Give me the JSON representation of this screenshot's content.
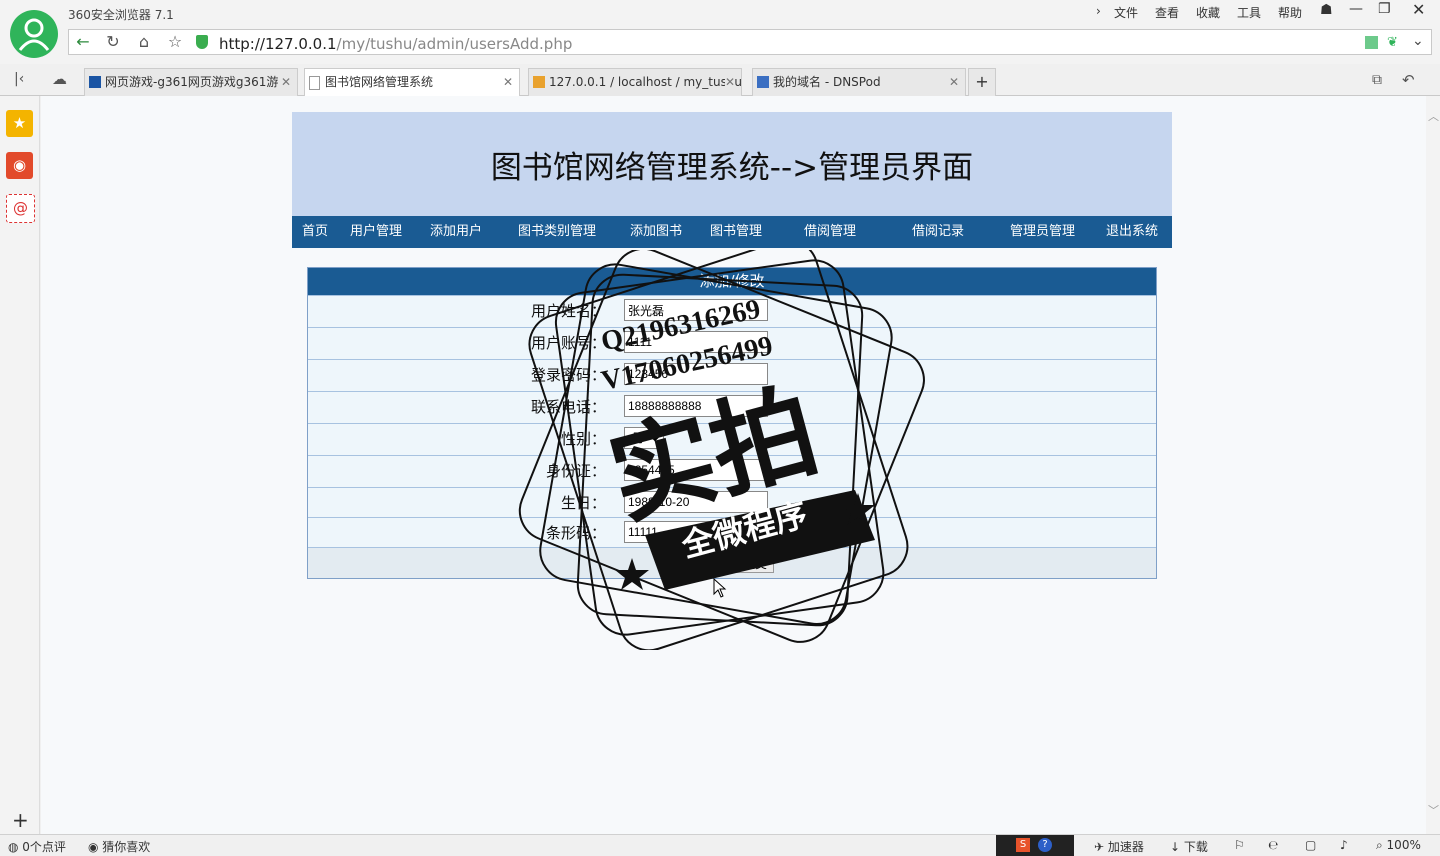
{
  "browser": {
    "title": "360安全浏览器 7.1",
    "menu": [
      "文件",
      "查看",
      "收藏",
      "工具",
      "帮助"
    ],
    "url_host": "http://127.0.0.1",
    "url_path": "/my/tushu/admin/usersAdd.php"
  },
  "tabs": [
    {
      "label": "网页游戏-g361网页游戏g361游",
      "icon": "g361-icon"
    },
    {
      "label": "图书馆网络管理系统",
      "icon": "page-icon"
    },
    {
      "label": "127.0.0.1 / localhost / my_tushu",
      "icon": "phpmyadmin-icon"
    },
    {
      "label": "我的域名 - DNSPod",
      "icon": "dnspod-icon"
    }
  ],
  "page": {
    "title": "图书馆网络管理系统-->管理员界面",
    "nav": [
      "首页",
      "用户管理",
      "添加用户",
      "图书类别管理",
      "添加图书",
      "图书管理",
      "借阅管理",
      "借阅记录",
      "管理员管理",
      "退出系统"
    ],
    "form": {
      "heading": "添加/修改",
      "fields": [
        {
          "label": "用户姓名：",
          "value": "张光磊"
        },
        {
          "label": "用户账号：",
          "value": "1111"
        },
        {
          "label": "登录密码：",
          "value": "123456"
        },
        {
          "label": "联系电话：",
          "value": "18888888888"
        },
        {
          "label": "性别：",
          "value": "男"
        },
        {
          "label": "身份证：",
          "value": "1254455"
        },
        {
          "label": "生日：",
          "value": "1988-10-20"
        },
        {
          "label": "条形码：",
          "value": "11111"
        }
      ],
      "submit": "提交"
    }
  },
  "watermark": {
    "line1": "Q2196316269",
    "line2": "V17060256499",
    "big": "实拍",
    "banner": "全微程序"
  },
  "status": {
    "comments": "0个点评",
    "guess": "猜你喜欢",
    "accelerator": "加速器",
    "download": "下载",
    "zoom": "100%"
  },
  "colors": {
    "header_bg": "#c6d6ef",
    "nav_bg": "#1a5b93",
    "logo": "#2fb45a"
  }
}
